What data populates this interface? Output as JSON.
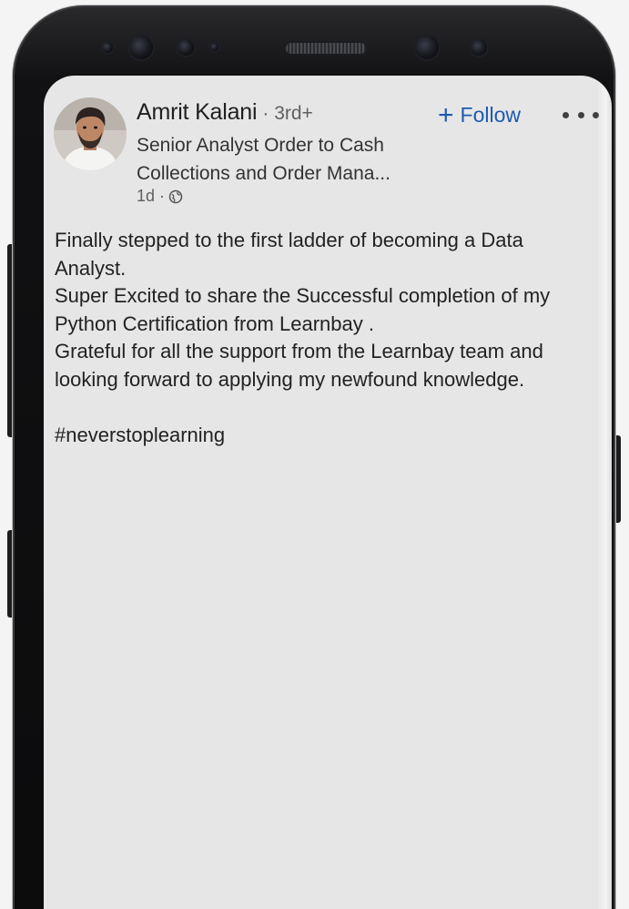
{
  "post": {
    "author": {
      "name": "Amrit Kalani",
      "degree": "· 3rd+",
      "headline_line1": "Senior Analyst Order to Cash",
      "headline_line2": "Collections and Order Mana...",
      "time": "1d ·",
      "visibility_icon": "globe-icon",
      "avatar_icon": "avatar"
    },
    "actions": {
      "follow_label": "Follow",
      "follow_icon": "plus-icon",
      "more_icon": "more-options-icon"
    },
    "body": {
      "line1": "Finally stepped to the first ladder of becoming a Data",
      "line2": "Analyst.",
      "line3": "Super Excited to share the Successful completion of my",
      "line4": "Python Certification from Learnbay .",
      "line5": "Grateful for all the support from the Learnbay team and",
      "line6": "looking forward to applying my newfound knowledge.",
      "hashtag": "#neverstoplearning"
    }
  },
  "colors": {
    "accent": "#1c5bb0",
    "screen_bg": "#e6e6e6",
    "text": "#222222"
  }
}
